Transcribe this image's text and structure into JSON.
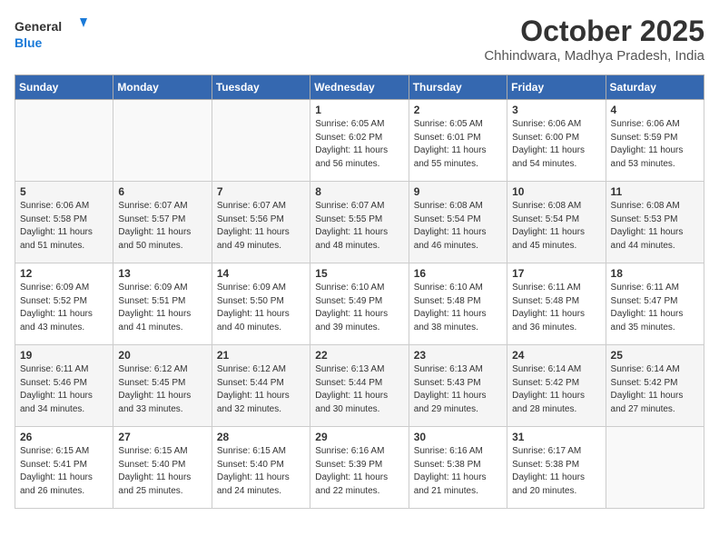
{
  "header": {
    "logo_line1": "General",
    "logo_line2": "Blue",
    "month": "October 2025",
    "location": "Chhindwara, Madhya Pradesh, India"
  },
  "weekdays": [
    "Sunday",
    "Monday",
    "Tuesday",
    "Wednesday",
    "Thursday",
    "Friday",
    "Saturday"
  ],
  "weeks": [
    [
      {
        "day": "",
        "info": ""
      },
      {
        "day": "",
        "info": ""
      },
      {
        "day": "",
        "info": ""
      },
      {
        "day": "1",
        "info": "Sunrise: 6:05 AM\nSunset: 6:02 PM\nDaylight: 11 hours\nand 56 minutes."
      },
      {
        "day": "2",
        "info": "Sunrise: 6:05 AM\nSunset: 6:01 PM\nDaylight: 11 hours\nand 55 minutes."
      },
      {
        "day": "3",
        "info": "Sunrise: 6:06 AM\nSunset: 6:00 PM\nDaylight: 11 hours\nand 54 minutes."
      },
      {
        "day": "4",
        "info": "Sunrise: 6:06 AM\nSunset: 5:59 PM\nDaylight: 11 hours\nand 53 minutes."
      }
    ],
    [
      {
        "day": "5",
        "info": "Sunrise: 6:06 AM\nSunset: 5:58 PM\nDaylight: 11 hours\nand 51 minutes."
      },
      {
        "day": "6",
        "info": "Sunrise: 6:07 AM\nSunset: 5:57 PM\nDaylight: 11 hours\nand 50 minutes."
      },
      {
        "day": "7",
        "info": "Sunrise: 6:07 AM\nSunset: 5:56 PM\nDaylight: 11 hours\nand 49 minutes."
      },
      {
        "day": "8",
        "info": "Sunrise: 6:07 AM\nSunset: 5:55 PM\nDaylight: 11 hours\nand 48 minutes."
      },
      {
        "day": "9",
        "info": "Sunrise: 6:08 AM\nSunset: 5:54 PM\nDaylight: 11 hours\nand 46 minutes."
      },
      {
        "day": "10",
        "info": "Sunrise: 6:08 AM\nSunset: 5:54 PM\nDaylight: 11 hours\nand 45 minutes."
      },
      {
        "day": "11",
        "info": "Sunrise: 6:08 AM\nSunset: 5:53 PM\nDaylight: 11 hours\nand 44 minutes."
      }
    ],
    [
      {
        "day": "12",
        "info": "Sunrise: 6:09 AM\nSunset: 5:52 PM\nDaylight: 11 hours\nand 43 minutes."
      },
      {
        "day": "13",
        "info": "Sunrise: 6:09 AM\nSunset: 5:51 PM\nDaylight: 11 hours\nand 41 minutes."
      },
      {
        "day": "14",
        "info": "Sunrise: 6:09 AM\nSunset: 5:50 PM\nDaylight: 11 hours\nand 40 minutes."
      },
      {
        "day": "15",
        "info": "Sunrise: 6:10 AM\nSunset: 5:49 PM\nDaylight: 11 hours\nand 39 minutes."
      },
      {
        "day": "16",
        "info": "Sunrise: 6:10 AM\nSunset: 5:48 PM\nDaylight: 11 hours\nand 38 minutes."
      },
      {
        "day": "17",
        "info": "Sunrise: 6:11 AM\nSunset: 5:48 PM\nDaylight: 11 hours\nand 36 minutes."
      },
      {
        "day": "18",
        "info": "Sunrise: 6:11 AM\nSunset: 5:47 PM\nDaylight: 11 hours\nand 35 minutes."
      }
    ],
    [
      {
        "day": "19",
        "info": "Sunrise: 6:11 AM\nSunset: 5:46 PM\nDaylight: 11 hours\nand 34 minutes."
      },
      {
        "day": "20",
        "info": "Sunrise: 6:12 AM\nSunset: 5:45 PM\nDaylight: 11 hours\nand 33 minutes."
      },
      {
        "day": "21",
        "info": "Sunrise: 6:12 AM\nSunset: 5:44 PM\nDaylight: 11 hours\nand 32 minutes."
      },
      {
        "day": "22",
        "info": "Sunrise: 6:13 AM\nSunset: 5:44 PM\nDaylight: 11 hours\nand 30 minutes."
      },
      {
        "day": "23",
        "info": "Sunrise: 6:13 AM\nSunset: 5:43 PM\nDaylight: 11 hours\nand 29 minutes."
      },
      {
        "day": "24",
        "info": "Sunrise: 6:14 AM\nSunset: 5:42 PM\nDaylight: 11 hours\nand 28 minutes."
      },
      {
        "day": "25",
        "info": "Sunrise: 6:14 AM\nSunset: 5:42 PM\nDaylight: 11 hours\nand 27 minutes."
      }
    ],
    [
      {
        "day": "26",
        "info": "Sunrise: 6:15 AM\nSunset: 5:41 PM\nDaylight: 11 hours\nand 26 minutes."
      },
      {
        "day": "27",
        "info": "Sunrise: 6:15 AM\nSunset: 5:40 PM\nDaylight: 11 hours\nand 25 minutes."
      },
      {
        "day": "28",
        "info": "Sunrise: 6:15 AM\nSunset: 5:40 PM\nDaylight: 11 hours\nand 24 minutes."
      },
      {
        "day": "29",
        "info": "Sunrise: 6:16 AM\nSunset: 5:39 PM\nDaylight: 11 hours\nand 22 minutes."
      },
      {
        "day": "30",
        "info": "Sunrise: 6:16 AM\nSunset: 5:38 PM\nDaylight: 11 hours\nand 21 minutes."
      },
      {
        "day": "31",
        "info": "Sunrise: 6:17 AM\nSunset: 5:38 PM\nDaylight: 11 hours\nand 20 minutes."
      },
      {
        "day": "",
        "info": ""
      }
    ]
  ]
}
